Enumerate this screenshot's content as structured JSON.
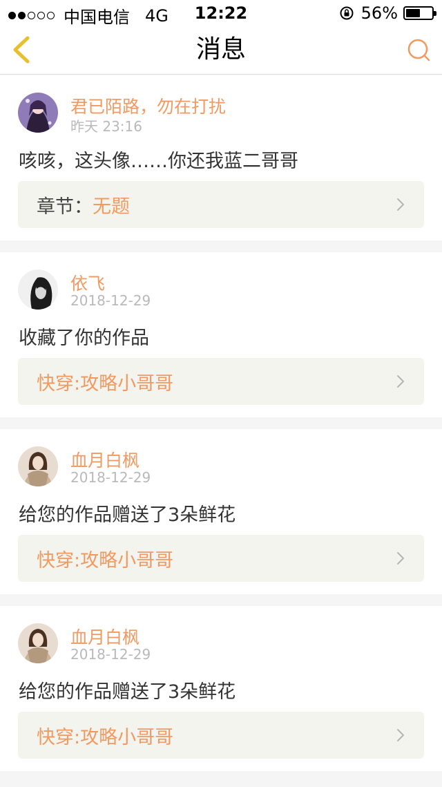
{
  "status_bar": {
    "carrier": "中国电信",
    "network": "4G",
    "time": "12:22",
    "battery": "56%",
    "battery_level": 0.56
  },
  "nav": {
    "title": "消息",
    "back_icon": "chevron-left-icon",
    "search_icon": "search-icon"
  },
  "colors": {
    "accent": "#f09a62",
    "box_bg": "#f4f4ee",
    "timestamp": "#b9b9b9",
    "back_icon": "#e8c02f"
  },
  "messages": [
    {
      "username": "君已陌路，勿在打扰",
      "time": "昨天 23:16",
      "content": "咳咳，这头像……你还我蓝二哥哥",
      "work_prefix": "章节：",
      "work_title": "无题"
    },
    {
      "username": "依飞",
      "time": "2018-12-29",
      "content": "收藏了你的作品",
      "work_prefix": "",
      "work_title": "快穿:攻略小哥哥"
    },
    {
      "username": "血月白枫",
      "time": "2018-12-29",
      "content": "给您的作品赠送了3朵鲜花",
      "work_prefix": "",
      "work_title": "快穿:攻略小哥哥"
    },
    {
      "username": "血月白枫",
      "time": "2018-12-29",
      "content": "给您的作品赠送了3朵鲜花",
      "work_prefix": "",
      "work_title": "快穿:攻略小哥哥"
    }
  ]
}
